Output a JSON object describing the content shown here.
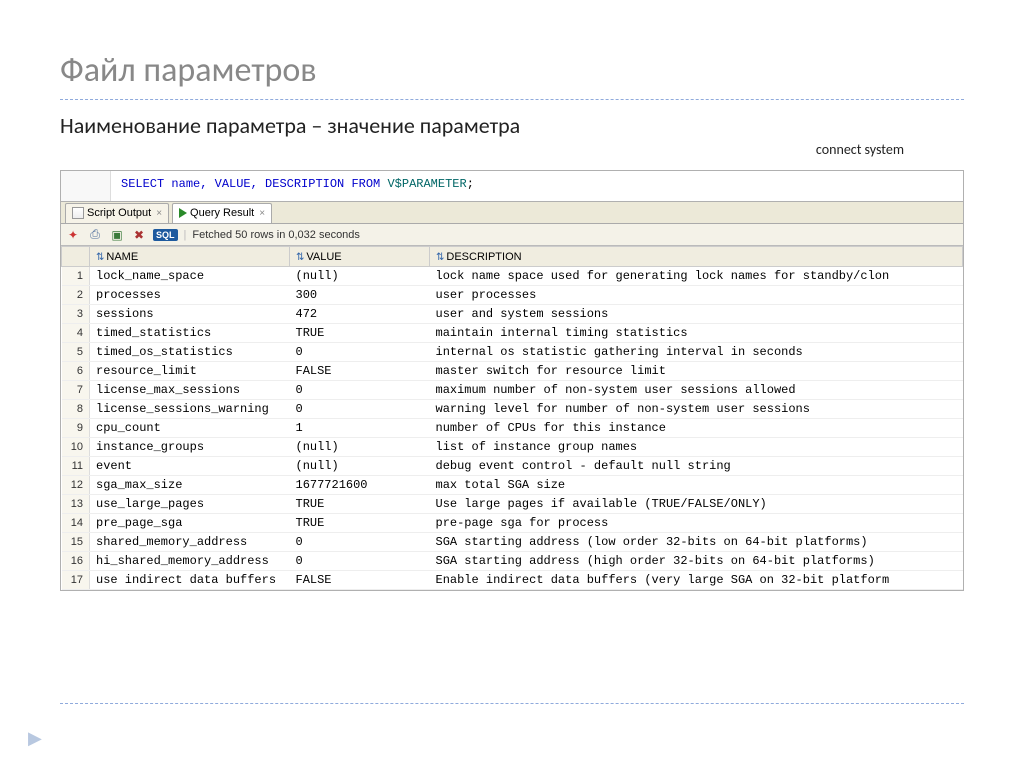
{
  "title": "Файл параметров",
  "subtitle": "Наименование параметра – значение параметра",
  "connect_label": "connect system",
  "sql_query": {
    "select": "SELECT",
    "cols": "name, VALUE, DESCRIPTION",
    "from": "FROM",
    "table": "V$PARAMETER",
    "semi": ";"
  },
  "tabs": {
    "script_output": "Script Output",
    "query_result": "Query Result"
  },
  "toolbar": {
    "sql_badge": "SQL",
    "fetch_status": "Fetched 50 rows in 0,032 seconds"
  },
  "columns": {
    "name": "NAME",
    "value": "VALUE",
    "description": "DESCRIPTION"
  },
  "rows": [
    {
      "n": "1",
      "name": "lock_name_space",
      "value": "(null)",
      "desc": "lock name space used for generating lock names for standby/clon"
    },
    {
      "n": "2",
      "name": "processes",
      "value": "300",
      "desc": "user processes"
    },
    {
      "n": "3",
      "name": "sessions",
      "value": "472",
      "desc": "user and system sessions"
    },
    {
      "n": "4",
      "name": "timed_statistics",
      "value": "TRUE",
      "desc": "maintain internal timing statistics"
    },
    {
      "n": "5",
      "name": "timed_os_statistics",
      "value": "0",
      "desc": "internal os statistic gathering interval in seconds"
    },
    {
      "n": "6",
      "name": "resource_limit",
      "value": "FALSE",
      "desc": "master switch for resource limit"
    },
    {
      "n": "7",
      "name": "license_max_sessions",
      "value": "0",
      "desc": "maximum number of non-system user sessions allowed"
    },
    {
      "n": "8",
      "name": "license_sessions_warning",
      "value": "0",
      "desc": "warning level for number of non-system user sessions"
    },
    {
      "n": "9",
      "name": "cpu_count",
      "value": "1",
      "desc": "number of CPUs for this instance"
    },
    {
      "n": "10",
      "name": "instance_groups",
      "value": "(null)",
      "desc": "list of instance group names"
    },
    {
      "n": "11",
      "name": "event",
      "value": "(null)",
      "desc": "debug event control - default null string"
    },
    {
      "n": "12",
      "name": "sga_max_size",
      "value": "1677721600",
      "desc": "max total SGA size"
    },
    {
      "n": "13",
      "name": "use_large_pages",
      "value": "TRUE",
      "desc": "Use large pages if available (TRUE/FALSE/ONLY)"
    },
    {
      "n": "14",
      "name": "pre_page_sga",
      "value": "TRUE",
      "desc": "pre-page sga for process"
    },
    {
      "n": "15",
      "name": "shared_memory_address",
      "value": "0",
      "desc": "SGA starting address (low order 32-bits on 64-bit platforms)"
    },
    {
      "n": "16",
      "name": "hi_shared_memory_address",
      "value": "0",
      "desc": "SGA starting address (high order 32-bits on 64-bit platforms)"
    },
    {
      "n": "17",
      "name": "use indirect data buffers",
      "value": "FALSE",
      "desc": "Enable indirect data buffers (very large SGA on 32-bit platform"
    }
  ]
}
